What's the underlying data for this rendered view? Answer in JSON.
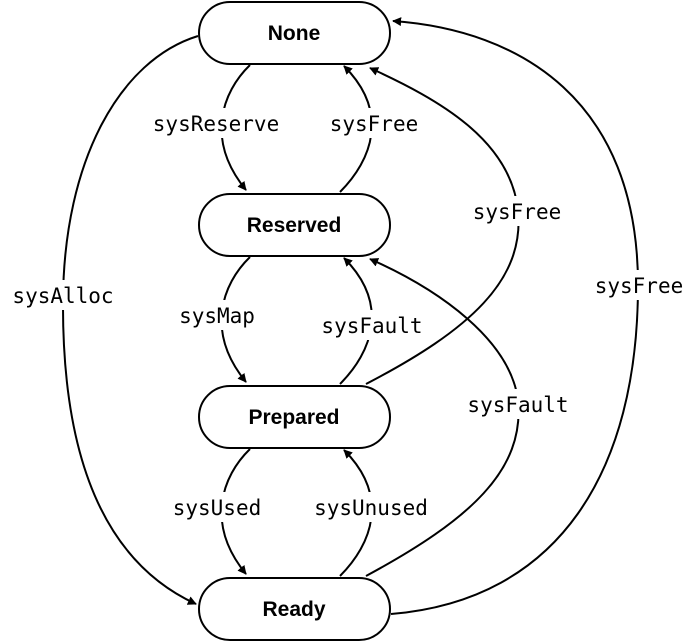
{
  "diagram": {
    "type": "state-machine",
    "nodes": [
      {
        "id": "none",
        "label": "None"
      },
      {
        "id": "reserved",
        "label": "Reserved"
      },
      {
        "id": "prepared",
        "label": "Prepared"
      },
      {
        "id": "ready",
        "label": "Ready"
      }
    ],
    "edges": [
      {
        "from": "none",
        "to": "reserved",
        "label": "sysReserve"
      },
      {
        "from": "reserved",
        "to": "none",
        "label": "sysFree"
      },
      {
        "from": "reserved",
        "to": "prepared",
        "label": "sysMap"
      },
      {
        "from": "prepared",
        "to": "reserved",
        "label": "sysFault"
      },
      {
        "from": "prepared",
        "to": "ready",
        "label": "sysUsed"
      },
      {
        "from": "ready",
        "to": "prepared",
        "label": "sysUnused"
      },
      {
        "from": "prepared",
        "to": "none",
        "label": "sysFree"
      },
      {
        "from": "ready",
        "to": "reserved",
        "label": "sysFault"
      },
      {
        "from": "none",
        "to": "ready",
        "label": "sysAlloc"
      },
      {
        "from": "ready",
        "to": "none",
        "label": "sysFree"
      }
    ]
  }
}
